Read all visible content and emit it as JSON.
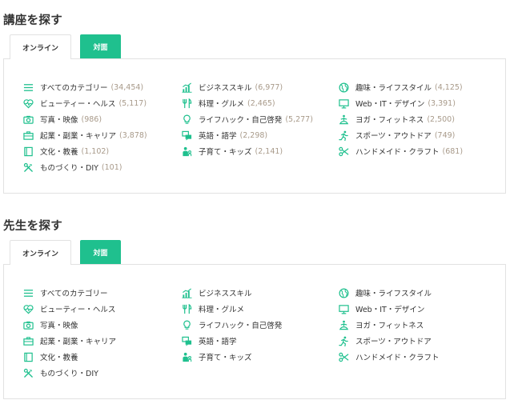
{
  "accent_color": "#1fc08e",
  "count_color": "#a89a8a",
  "courses": {
    "title": "講座を探す",
    "tabs": [
      {
        "label": "オンライン",
        "active": true
      },
      {
        "label": "対面",
        "active": false
      }
    ],
    "columns": [
      [
        {
          "icon": "list-icon",
          "label": "すべてのカテゴリー",
          "count": "(34,454)"
        },
        {
          "icon": "heart-pulse-icon",
          "label": "ビューティー・ヘルス",
          "count": "(5,117)"
        },
        {
          "icon": "camera-icon",
          "label": "写真・映像",
          "count": "(986)"
        },
        {
          "icon": "briefcase-icon",
          "label": "起業・副業・キャリア",
          "count": "(3,878)"
        },
        {
          "icon": "book-icon",
          "label": "文化・教養",
          "count": "(1,102)"
        },
        {
          "icon": "tools-icon",
          "label": "ものづくり・DIY",
          "count": "(101)"
        }
      ],
      [
        {
          "icon": "chart-icon",
          "label": "ビジネススキル",
          "count": "(6,977)"
        },
        {
          "icon": "fork-knife-icon",
          "label": "料理・グルメ",
          "count": "(2,465)"
        },
        {
          "icon": "lightbulb-icon",
          "label": "ライフハック・自己啓発",
          "count": "(5,277)"
        },
        {
          "icon": "chat-icon",
          "label": "英語・語学",
          "count": "(2,298)"
        },
        {
          "icon": "parent-child-icon",
          "label": "子育て・キッズ",
          "count": "(2,141)"
        }
      ],
      [
        {
          "icon": "globe-icon",
          "label": "趣味・ライフスタイル",
          "count": "(4,125)"
        },
        {
          "icon": "monitor-icon",
          "label": "Web・IT・デザイン",
          "count": "(3,391)"
        },
        {
          "icon": "yoga-icon",
          "label": "ヨガ・フィットネス",
          "count": "(2,500)"
        },
        {
          "icon": "running-icon",
          "label": "スポーツ・アウトドア",
          "count": "(749)"
        },
        {
          "icon": "scissors-icon",
          "label": "ハンドメイド・クラフト",
          "count": "(681)"
        }
      ]
    ]
  },
  "teachers": {
    "title": "先生を探す",
    "tabs": [
      {
        "label": "オンライン",
        "active": true
      },
      {
        "label": "対面",
        "active": false
      }
    ],
    "columns": [
      [
        {
          "icon": "list-icon",
          "label": "すべてのカテゴリー"
        },
        {
          "icon": "heart-pulse-icon",
          "label": "ビューティー・ヘルス"
        },
        {
          "icon": "camera-icon",
          "label": "写真・映像"
        },
        {
          "icon": "briefcase-icon",
          "label": "起業・副業・キャリア"
        },
        {
          "icon": "book-icon",
          "label": "文化・教養"
        },
        {
          "icon": "tools-icon",
          "label": "ものづくり・DIY"
        }
      ],
      [
        {
          "icon": "chart-icon",
          "label": "ビジネススキル"
        },
        {
          "icon": "fork-knife-icon",
          "label": "料理・グルメ"
        },
        {
          "icon": "lightbulb-icon",
          "label": "ライフハック・自己啓発"
        },
        {
          "icon": "chat-icon",
          "label": "英語・語学"
        },
        {
          "icon": "parent-child-icon",
          "label": "子育て・キッズ"
        }
      ],
      [
        {
          "icon": "globe-icon",
          "label": "趣味・ライフスタイル"
        },
        {
          "icon": "monitor-icon",
          "label": "Web・IT・デザイン"
        },
        {
          "icon": "yoga-icon",
          "label": "ヨガ・フィットネス"
        },
        {
          "icon": "running-icon",
          "label": "スポーツ・アウトドア"
        },
        {
          "icon": "scissors-icon",
          "label": "ハンドメイド・クラフト"
        }
      ]
    ]
  }
}
